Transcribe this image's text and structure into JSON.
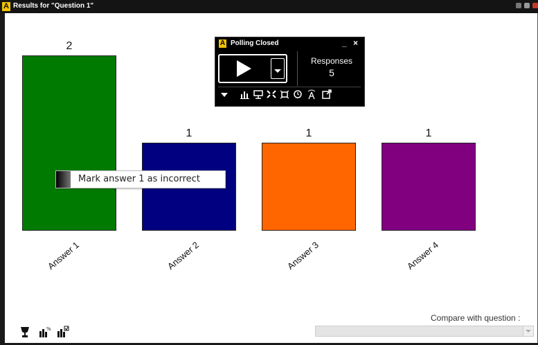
{
  "window": {
    "title": "Results for \"Question 1\"",
    "logo_letter": "A"
  },
  "chart_data": {
    "type": "bar",
    "categories": [
      "Answer 1",
      "Answer 2",
      "Answer 3",
      "Answer 4"
    ],
    "values": [
      2,
      1,
      1,
      1
    ],
    "colors": [
      "#007a00",
      "#000080",
      "#ff6600",
      "#800080"
    ],
    "ylim": [
      0,
      2
    ]
  },
  "tooltip": {
    "text": "Mark answer 1 as incorrect"
  },
  "poll_panel": {
    "title": "Polling Closed",
    "minimize": "_",
    "close": "×",
    "responses_label": "Responses",
    "responses_count": "5",
    "toolbar_icons": [
      "dropdown-icon",
      "chart-icon",
      "present-icon",
      "fullscreen-icon",
      "fit-icon",
      "timer-icon",
      "broadcast-icon",
      "popout-icon"
    ]
  },
  "bottom": {
    "compare_label": "Compare with question :",
    "compare_value": "",
    "icons": [
      "trophy-icon",
      "percent-chart-icon",
      "check-chart-icon"
    ]
  }
}
